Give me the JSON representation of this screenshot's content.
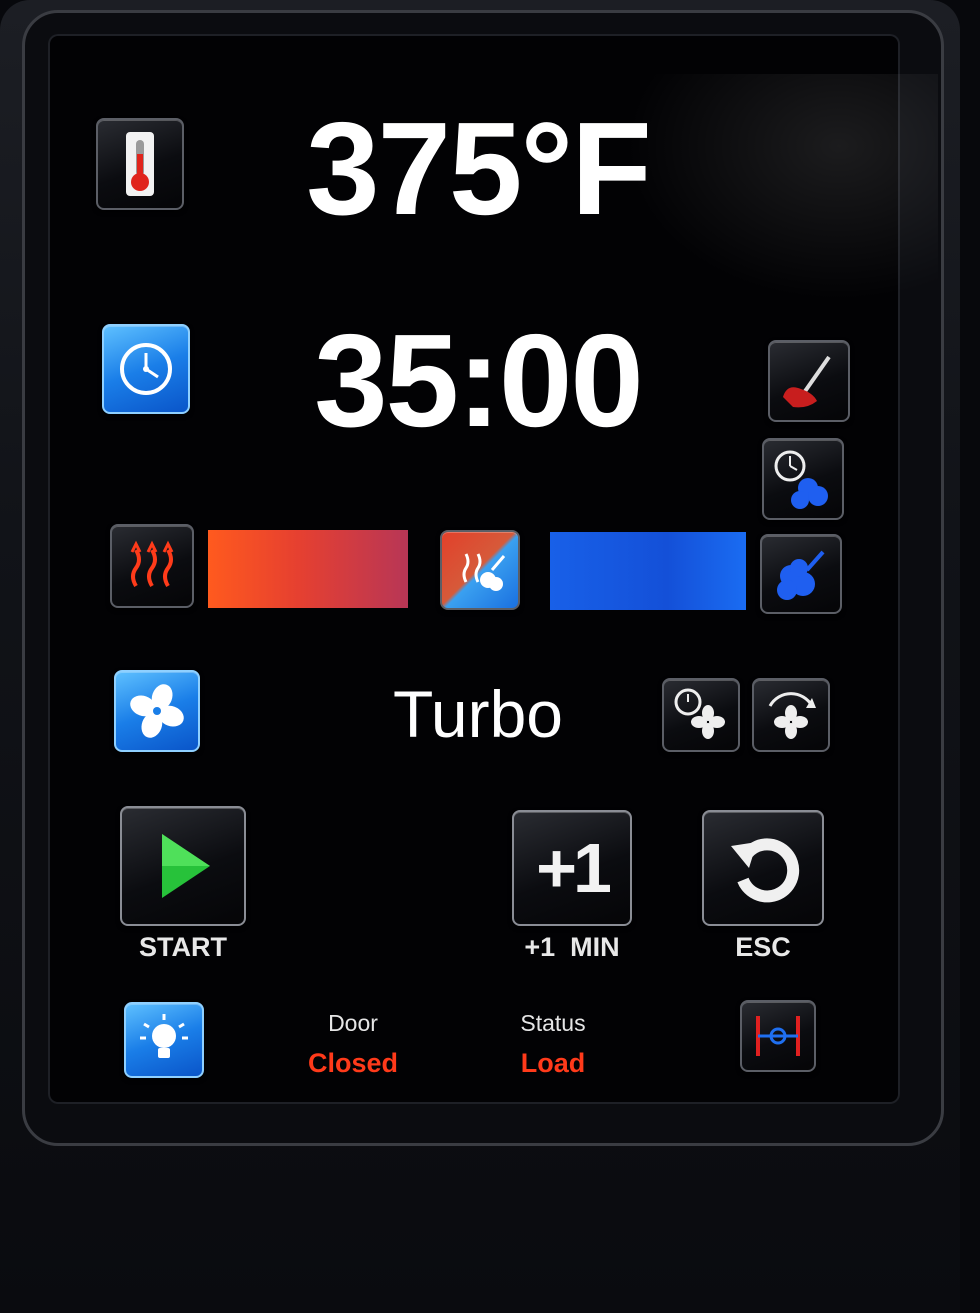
{
  "display": {
    "temperature": "375°F",
    "timer": "35:00",
    "fan_mode": "Turbo"
  },
  "buttons": {
    "start_label": "START",
    "plus_one_label": "+1  MIN",
    "plus_one_glyph": "+1",
    "esc_label": "ESC"
  },
  "status": {
    "door_label": "Door",
    "door_value": "Closed",
    "status_label": "Status",
    "status_value": "Load"
  },
  "icons": [
    "thermometer-icon",
    "clock-icon",
    "probe-icon",
    "steam-timer-icon",
    "heat-icon",
    "combi-icon",
    "steam-icon",
    "fan-icon",
    "fan-timer-icon",
    "fan-speed-icon",
    "play-icon",
    "plus-one-icon",
    "back-icon",
    "light-icon",
    "damper-icon"
  ],
  "colors": {
    "heat_bar": "#ff5a1e",
    "steam_bar": "#1860e8",
    "status_value": "#ff3a1a",
    "start_arrow": "#27c23a",
    "accent_blue": "#1a7ee8"
  },
  "levels": {
    "heat_bar_fill": 1.0,
    "steam_bar_fill": 1.0
  }
}
